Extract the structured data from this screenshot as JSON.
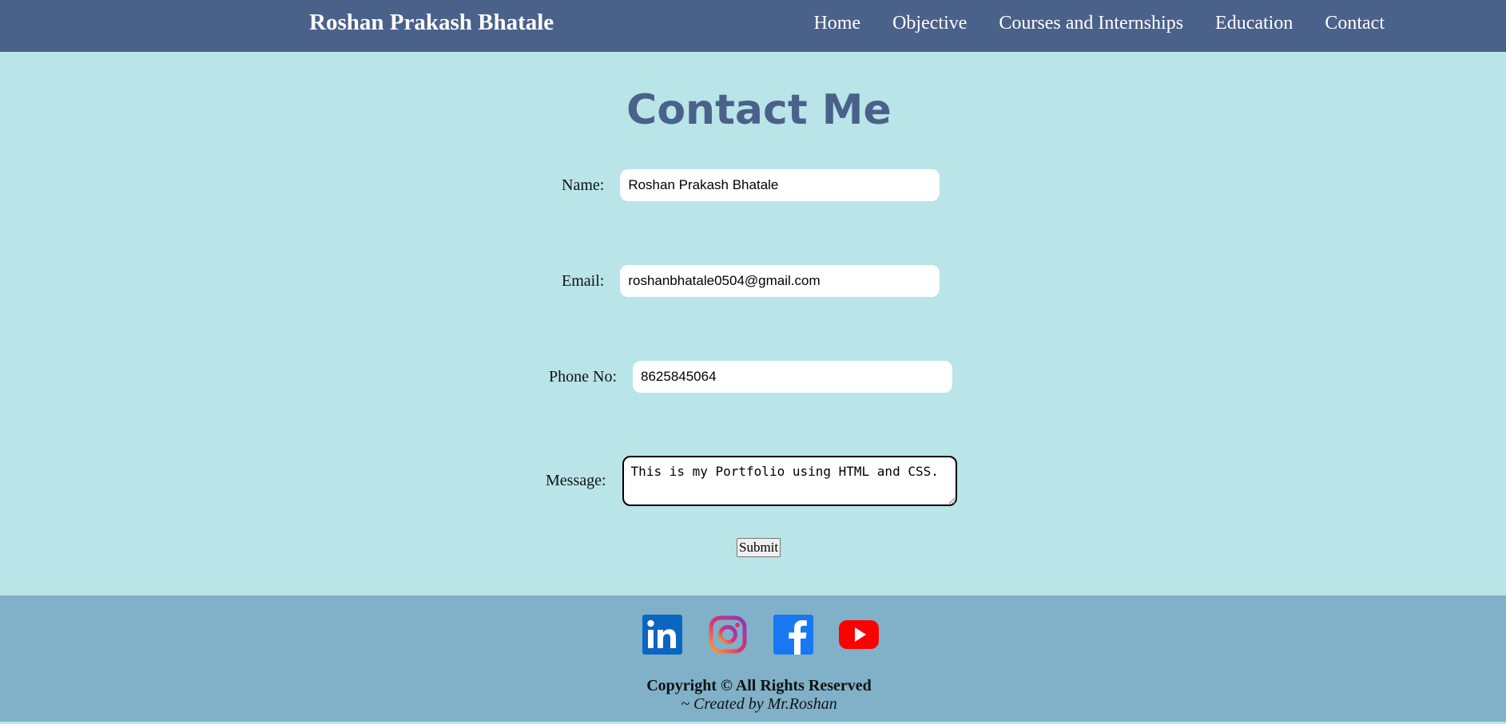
{
  "header": {
    "brand": "Roshan Prakash Bhatale",
    "nav": [
      "Home",
      "Objective",
      "Courses and Internships",
      "Education",
      "Contact"
    ]
  },
  "main": {
    "heading": "Contact Me",
    "form": {
      "name_label": "Name:",
      "name_value": "Roshan Prakash Bhatale",
      "email_label": "Email:",
      "email_value": "roshanbhatale0504@gmail.com",
      "phone_label": "Phone No:",
      "phone_value": "8625845064",
      "message_label": "Message:",
      "message_value": "This is my Portfolio using HTML and CSS.",
      "submit_label": "Submit"
    }
  },
  "footer": {
    "social": [
      "linkedin-icon",
      "instagram-icon",
      "facebook-icon",
      "youtube-icon"
    ],
    "copyright": "Copyright © All Rights Reserved",
    "created_by": "~ Created by Mr.Roshan"
  },
  "colors": {
    "navbar": "#4a618a",
    "page_bg": "#b9e4e8",
    "footer_bg": "#80b1c8",
    "heading": "#4a618a"
  }
}
